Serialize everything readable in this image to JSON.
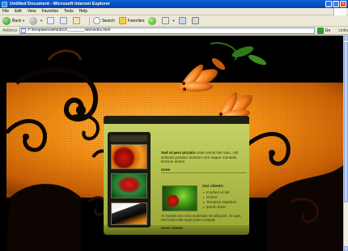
{
  "window": {
    "title": "Untitled Document - Microsoft Internet Explorer",
    "min": "_",
    "max": "□",
    "close": "×"
  },
  "menubar": {
    "items": [
      "File",
      "Edit",
      "View",
      "Favorites",
      "Tools",
      "Help"
    ]
  },
  "toolbar": {
    "back_label": "Back",
    "search_label": "Search",
    "favorites_label": "Favorites",
    "icons": [
      "back-icon",
      "forward-icon",
      "stop-icon",
      "refresh-icon",
      "home-icon",
      "search-icon",
      "favorites-icon",
      "media-icon",
      "history-icon",
      "mail-icon",
      "print-icon"
    ]
  },
  "address": {
    "label": "Address",
    "value": "F:\\templates\\delta\\912\\________\\site\\index.html",
    "go_label": "Go",
    "links_label": "Links"
  },
  "page": {
    "intro_heading": "Sed ut pers piciatis",
    "intro_body": " unde omnis iste natu, volt setsedu portatur dolorem rem eaque ronntatis feritune delore.",
    "more_link_1": "more",
    "clients_title": "Our clients:",
    "clients": [
      "Incidunt ut lab",
      "Dolore",
      "Tempora saipetion",
      "Ipsum dolor"
    ],
    "clients_desc": "At mavela nec eros molestiae est aliquam, mi eget. Sed velit nulla turpis justo volutpat.",
    "more_link_2": "more clients"
  },
  "colors": {
    "xp_blue": "#0a5fd8",
    "band_orange": "#f08d13",
    "panel_green": "#b6c352"
  }
}
